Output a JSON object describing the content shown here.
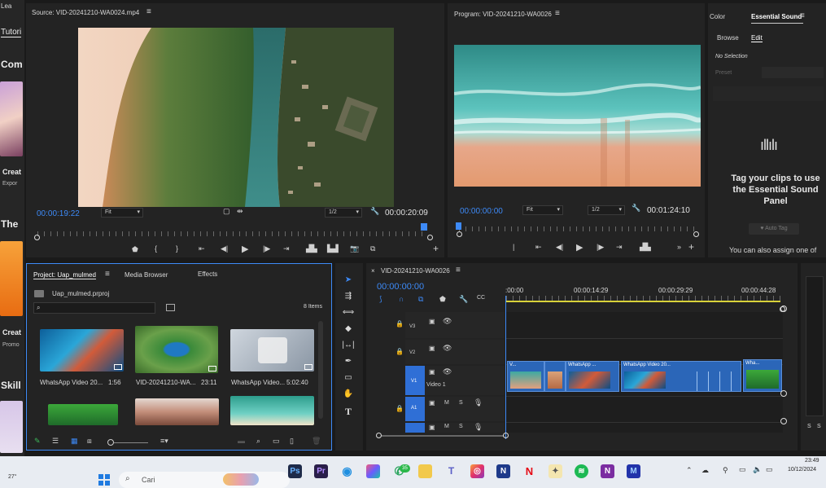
{
  "colors": {
    "accent": "#3d8af7",
    "timecode": "#3d8af7",
    "playhead": "#2f6fd6"
  },
  "sidebar": {
    "title": "Lea",
    "tab": "Tutori",
    "items": [
      {
        "heading": "Com"
      },
      {
        "heading": "Creat",
        "sub": "Expor"
      },
      {
        "heading": "The"
      },
      {
        "heading": "Creat",
        "sub": "Promo"
      },
      {
        "heading": "Skill"
      }
    ]
  },
  "source": {
    "title": "Source: VID-20241210-WA0024.mp4",
    "timecode": "00:00:19:22",
    "fit": "Fit",
    "res": "1/2",
    "duration": "00:00:20:09"
  },
  "program": {
    "title": "Program: VID-20241210-WA0026",
    "timecode": "00:00:00:00",
    "fit": "Fit",
    "res": "1/2",
    "duration": "00:01:24:10"
  },
  "essential": {
    "tab_color": "Color",
    "tab_sound": "Essential Sound",
    "browse": "Browse",
    "edit": "Edit",
    "no_selection": "No Selection",
    "preset": "Preset",
    "message": "Tag your clips to use the Essential Sound Panel",
    "auto_tag": "Auto Tag",
    "assign": "You can also assign one of"
  },
  "project": {
    "title": "Project: Uap_mulmed",
    "tab_media": "Media Browser",
    "tab_effects": "Effects",
    "file": "Uap_mulmed.prproj",
    "count": "8 Items",
    "items": [
      {
        "name": "WhatsApp Video 20...",
        "duration": "1:56"
      },
      {
        "name": "VID-20241210-WA...",
        "duration": "23:11"
      },
      {
        "name": "WhatsApp Video...",
        "duration": "5:02:40"
      }
    ]
  },
  "timeline": {
    "tab": "VID-20241210-WA0026",
    "timecode": "00:00:00:00",
    "ruler": [
      ":00:00",
      "00:00:14:29",
      "00:00:29:29",
      "00:00:44:28"
    ],
    "tracks": {
      "v3": "V3",
      "v2": "V2",
      "v1": "V1",
      "video1": "Video 1",
      "a1": "A1",
      "m": "M",
      "s": "S"
    },
    "clips": [
      {
        "label": "V..."
      },
      {
        "label": ""
      },
      {
        "label": "WhatsApp ..."
      },
      {
        "label": "WhatsApp Video 20..."
      },
      {
        "label": "Wha..."
      }
    ]
  },
  "meter": {
    "s1": "S",
    "s2": "S"
  },
  "taskbar": {
    "weather": "27°",
    "search": "Cari",
    "time": "23:49",
    "date": "10/12/2024",
    "badge": "35"
  }
}
